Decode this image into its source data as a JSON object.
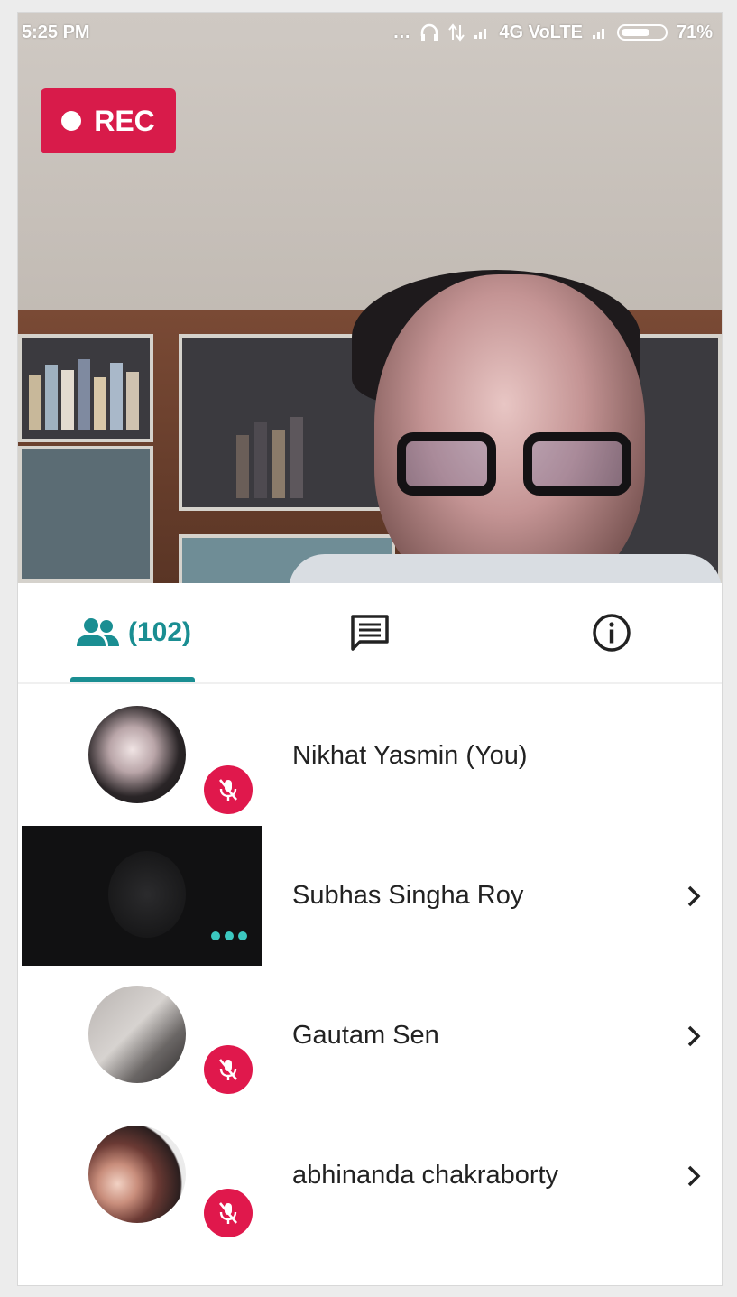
{
  "status_bar": {
    "time": "5:25 PM",
    "network": "4G VoLTE",
    "battery": "71%",
    "battery_level": 0.71,
    "icons": [
      "more-dots-icon",
      "headphones-icon",
      "data-arrows-icon",
      "signal-icon",
      "signal-icon"
    ]
  },
  "recording": {
    "label": "REC",
    "color": "#d81b4a"
  },
  "tabs": {
    "participants_count": "(102)",
    "active": "participants",
    "accent_color": "#1a8e92",
    "items": [
      {
        "id": "participants",
        "icon": "people-icon"
      },
      {
        "id": "chat",
        "icon": "chat-icon"
      },
      {
        "id": "info",
        "icon": "info-icon"
      }
    ]
  },
  "participants": [
    {
      "name": "Nikhat Yasmin (You)",
      "muted": true,
      "has_chevron": false
    },
    {
      "name": "Subhas Singha Roy",
      "muted": false,
      "video_on": true,
      "has_chevron": true
    },
    {
      "name": "Gautam Sen",
      "muted": true,
      "has_chevron": true
    },
    {
      "name": "abhinanda chakraborty",
      "muted": true,
      "has_chevron": true
    }
  ],
  "colors": {
    "mute_badge": "#e0184c",
    "video_dots": "#3cc8c0"
  }
}
